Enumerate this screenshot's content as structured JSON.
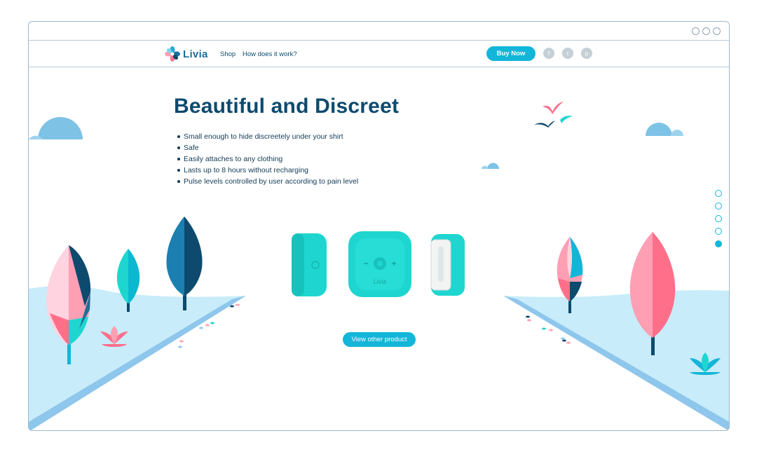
{
  "nav": {
    "logo_text": "Livia",
    "links": [
      "Shop",
      "How does it work?"
    ],
    "buy_label": "Buy Now",
    "social": [
      {
        "name": "facebook-icon",
        "glyph": "f"
      },
      {
        "name": "twitter-icon",
        "glyph": "t"
      },
      {
        "name": "pinterest-icon",
        "glyph": "p"
      }
    ]
  },
  "hero": {
    "title": "Beautiful and Discreet",
    "features": [
      "Small enough to hide discreetely under your shirt",
      "Safe",
      "Easily attaches to any clothing",
      "Lasts up to 8 hours without recharging",
      "Pulse levels controlled by user according to pain level"
    ],
    "product_label": "Livia",
    "cta_label": "View other product"
  },
  "pager": {
    "count": 5,
    "active_index": 4
  },
  "colors": {
    "accent": "#13b6d8",
    "navy": "#0d4a6e",
    "ground": "#c8ecf9",
    "pink": "#ff6f8a",
    "teal": "#1ed6cf"
  }
}
